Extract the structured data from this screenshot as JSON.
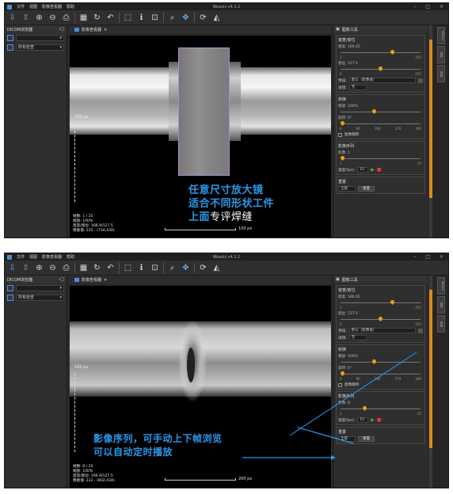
{
  "app": {
    "title": "Weasis v4.1.2",
    "menus": [
      "文件",
      "视图",
      "影像查看器",
      "帮助"
    ],
    "win_buttons": [
      "–",
      "□",
      "×"
    ]
  },
  "toolbar": {
    "icons": [
      "import-icon",
      "export-icon",
      "zoom-in-icon",
      "zoom-out-icon",
      "print-icon",
      "layout-icon",
      "refresh-icon",
      "undo-icon",
      "select-icon",
      "measure-icon",
      "roi-icon",
      "search-icon",
      "pan-icon",
      "rotate-icon",
      "flip-icon"
    ]
  },
  "left": {
    "title": "DICOM浏览器",
    "title_controls": "–□",
    "filter": "所有检查"
  },
  "viewer": {
    "tab_title": "影像查看器",
    "close": "✕"
  },
  "right": {
    "title": "图像工具",
    "wl": {
      "title": "窗宽/窗位",
      "window_label": "窗宽: 166.65",
      "window_max": "255",
      "level_label": "窗位: 127.5",
      "level_min": "0",
      "level_max": "255",
      "preset_label": "预设:",
      "preset_value": "默认（影像值）",
      "lut_label": "透镜:",
      "lut_value": "无"
    },
    "transform": {
      "title": "转换",
      "zoom_label": "缩放: 100%",
      "rotate_label": "旋转: 0°",
      "ticks": [
        "0",
        "90",
        "180",
        "270",
        "360"
      ],
      "flip_label": "图像翻转"
    },
    "cine": {
      "title": "影像序列",
      "frame_label_1": "影像: 1",
      "frame_label_2": "影像: 8",
      "min": "1",
      "max": "25",
      "speed_label": "速度(fps):",
      "speed_value": "10"
    },
    "reset": {
      "title": "重置",
      "select": "全部",
      "button": "重置"
    }
  },
  "side_tabs": [
    "Weasis",
    "插件",
    "测量"
  ],
  "overlay1": {
    "frame": "帧数: 1 / 25",
    "zoom": "缩放: 100%",
    "wl": "窗宽/窗位: 166.9/127.5",
    "pixel": "像素值: 225 - (734,430)",
    "ruler": "100 px",
    "scale": "100 px"
  },
  "overlay2": {
    "frame": "帧数: 8 / 25",
    "zoom": "缩放: 100%",
    "wl": "窗宽/窗位: 166.9/127.5",
    "pixel": "像素值: 222 - (802,434)",
    "ruler": "100 px",
    "scale": "200 px"
  },
  "captions": {
    "top_line1": "任意尺寸放大镜",
    "top_line2": "适合不同形状工件",
    "top_line3a": "上面",
    "top_line3b": "专评焊缝",
    "bottom_line1": "影像序列，可手动上下帧浏览",
    "bottom_line2": "可以自动定时播放"
  },
  "colors": {
    "accent": "#2a98e8",
    "slider": "#f39c12"
  }
}
